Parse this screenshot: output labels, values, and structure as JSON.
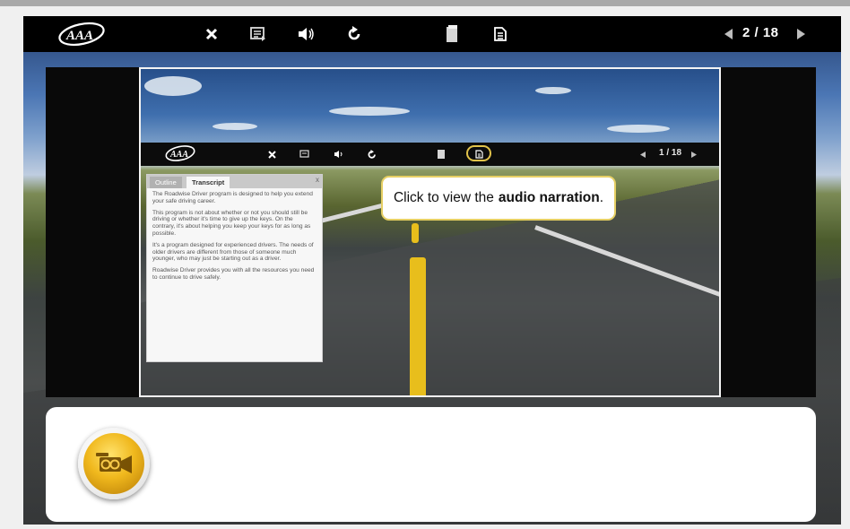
{
  "toolbar": {
    "logo": "AAA",
    "icons": [
      "close-icon",
      "transcript-menu-icon",
      "volume-icon",
      "replay-icon",
      "notes-icon",
      "document-icon",
      "prev-arrow-icon",
      "next-arrow-icon"
    ],
    "page_indicator": "2 / 18"
  },
  "slide": {
    "inner_toolbar": {
      "logo": "AAA",
      "page_indicator": "1 / 18"
    },
    "transcript_panel": {
      "tabs": [
        "Outline",
        "Transcript"
      ],
      "active_tab": "Transcript",
      "close_glyph": "x",
      "paragraphs": [
        "The Roadwise Driver program is designed to help you extend your safe driving career.",
        "This program is not about whether or not you should still be driving or whether it's time to give up the keys. On the contrary, it's about helping you keep your keys for as long as possible.",
        "It's a program designed for experienced drivers. The needs of older drivers are different from those of someone much younger, who may just be starting out as a driver.",
        "Roadwise Driver provides you with all the resources you need to continue to drive safely."
      ]
    },
    "callout": {
      "text": "Click to view the",
      "bold": "audio narration",
      "suffix": "."
    }
  },
  "bottom_panel": {
    "icon": "video-camera-icon"
  },
  "colors": {
    "accent_gold": "#f0b81d",
    "highlight": "#e2c34a",
    "toolbar_bg": "#000000"
  }
}
